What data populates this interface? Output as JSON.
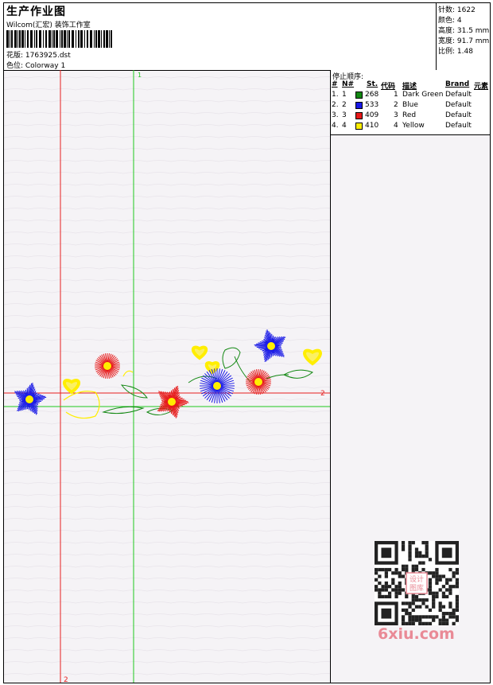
{
  "header": {
    "title": "生产作业图",
    "studio": "Wilcom(汇宏) 装饰工作室",
    "design": "花版: 1763925.dst",
    "colorway": "色位: Colorway 1"
  },
  "stats": [
    "针数: 1622",
    "颜色: 4",
    "高度: 31.5 mm",
    "宽度: 91.7 mm",
    "比例: 1.48"
  ],
  "stop_sequence": {
    "label": "停止顺序:",
    "headers": [
      "#",
      "N#",
      "St.",
      "代码",
      "描述",
      "Brand",
      "元素"
    ],
    "rows": [
      {
        "n": "1.",
        "needle": "1",
        "color": "#138813",
        "stitches": "268",
        "code": "1",
        "desc": "Dark Green",
        "brand": "Default"
      },
      {
        "n": "2.",
        "needle": "2",
        "color": "#1818e6",
        "stitches": "533",
        "code": "2",
        "desc": "Blue",
        "brand": "Default"
      },
      {
        "n": "3.",
        "needle": "3",
        "color": "#e61818",
        "stitches": "409",
        "code": "3",
        "desc": "Red",
        "brand": "Default"
      },
      {
        "n": "4.",
        "needle": "4",
        "color": "#ffee00",
        "stitches": "410",
        "code": "4",
        "desc": "Yellow",
        "brand": "Default"
      }
    ]
  },
  "axes": {
    "red_vertical_label": "2",
    "red_horizontal_label": "2",
    "green_vertical_label": "1"
  },
  "watermark": "6xiu.com",
  "qr_caption": "设计图库",
  "colors": {
    "green_line": "#1ec81e",
    "red_line": "#e61e1e",
    "blue": "#1818e6",
    "red": "#e61818",
    "yellow": "#ffee00",
    "green": "#138813"
  }
}
